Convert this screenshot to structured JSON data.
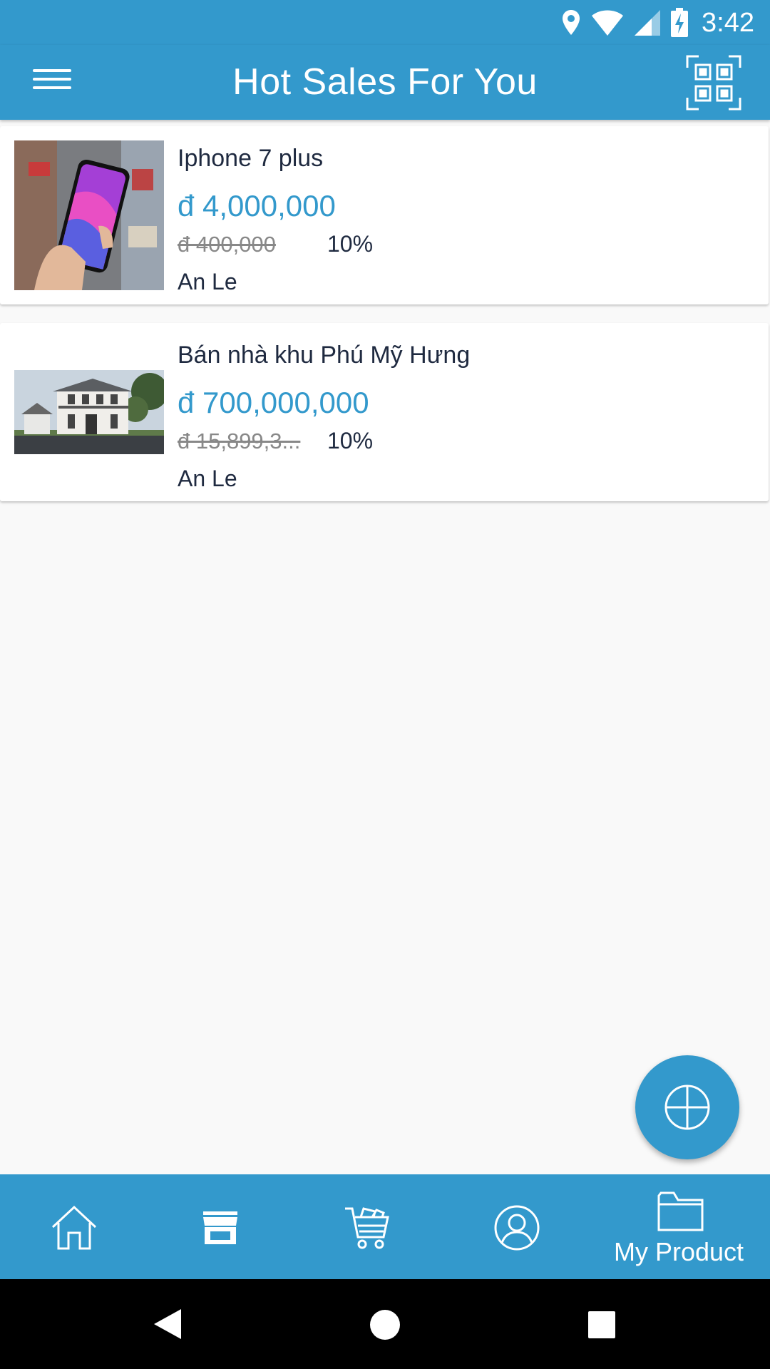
{
  "status": {
    "time": "3:42"
  },
  "app_bar": {
    "title": "Hot Sales For You"
  },
  "products": [
    {
      "title": "Iphone 7 plus",
      "price": "đ 4,000,000",
      "old_price": "đ 400,000",
      "discount": "10%",
      "seller": "An Le",
      "image": "phone-photo"
    },
    {
      "title": "Bán nhà khu Phú Mỹ Hưng",
      "price": "đ 700,000,000",
      "old_price": "đ 15,899,3...",
      "discount": "10%",
      "seller": "An Le",
      "image": "house-photo"
    }
  ],
  "bottom_nav": {
    "items": [
      {
        "icon": "home-icon"
      },
      {
        "icon": "store-icon"
      },
      {
        "icon": "cart-icon"
      },
      {
        "icon": "account-icon"
      },
      {
        "icon": "folder-icon",
        "label": "My Product"
      }
    ]
  },
  "colors": {
    "primary": "#3399cc",
    "background": "#f9f9f9",
    "text_dark": "#1f2a40",
    "old_price": "#888888"
  }
}
